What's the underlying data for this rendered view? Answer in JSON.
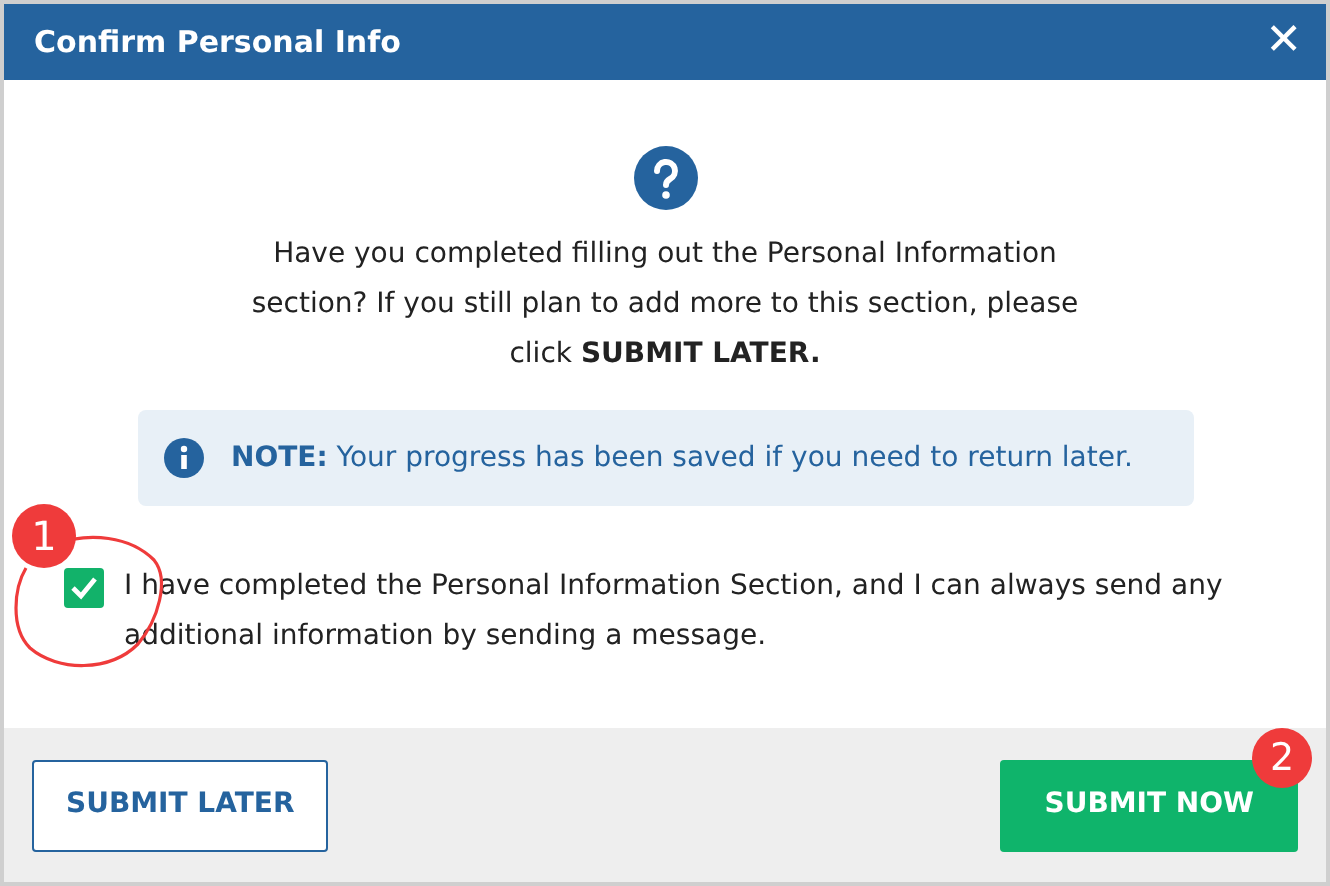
{
  "window": {
    "title": "Confirm Personal Info",
    "close": "✕"
  },
  "message": "Have you completed filling out the Personal Information section? If you still plan to add more to this section, please click **SUBMIT LATER.**",
  "note": {
    "text": "**NOTE:** Your progress has been saved if you need to return later."
  },
  "confirmation": {
    "label": "I have completed the Personal Information Section, and I can always send any additional information by sending a message.",
    "checked": true
  },
  "buttons": [
    {
      "label": "SUBMIT LATER",
      "kind": "outline"
    },
    {
      "label": "SUBMIT NOW",
      "kind": "primary"
    }
  ],
  "annotations": [
    {
      "label": "1"
    },
    {
      "label": "2"
    }
  ]
}
